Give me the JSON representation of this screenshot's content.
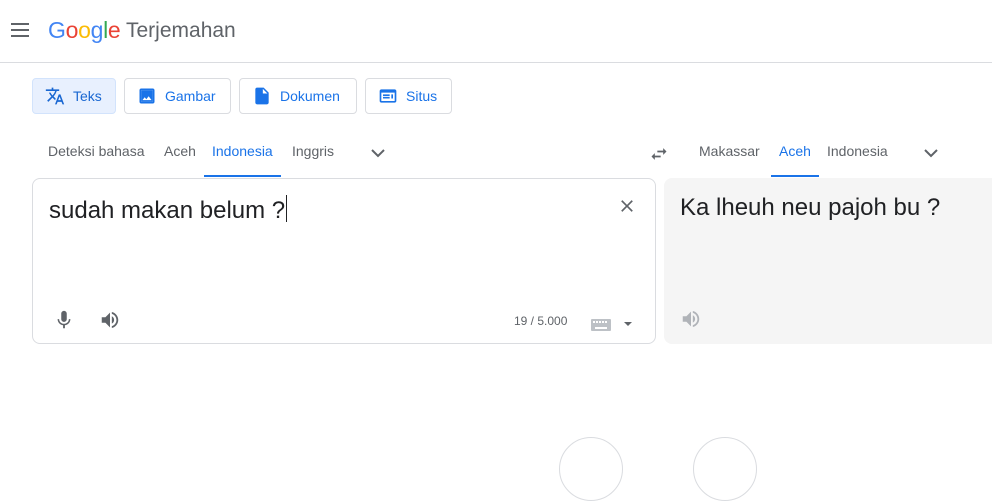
{
  "header": {
    "logo_letters": [
      "G",
      "o",
      "o",
      "g",
      "l",
      "e"
    ],
    "app_name": "Terjemahan"
  },
  "modes": [
    {
      "label": "Teks",
      "icon": "translate-icon",
      "active": true
    },
    {
      "label": "Gambar",
      "icon": "image-icon",
      "active": false
    },
    {
      "label": "Dokumen",
      "icon": "document-icon",
      "active": false
    },
    {
      "label": "Situs",
      "icon": "website-icon",
      "active": false
    }
  ],
  "source_langs": [
    "Deteksi bahasa",
    "Aceh",
    "Indonesia",
    "Inggris"
  ],
  "source_active": "Indonesia",
  "target_langs": [
    "Makassar",
    "Aceh",
    "Indonesia"
  ],
  "target_active": "Aceh",
  "source": {
    "text": "sudah makan belum ?",
    "char_count": "19 / 5.000"
  },
  "target": {
    "text": "Ka lheuh neu pajoh bu ?"
  },
  "colors": {
    "accent": "#1a73e8",
    "active_chip_bg": "#e8f0fe",
    "target_bg": "#f5f5f5"
  }
}
